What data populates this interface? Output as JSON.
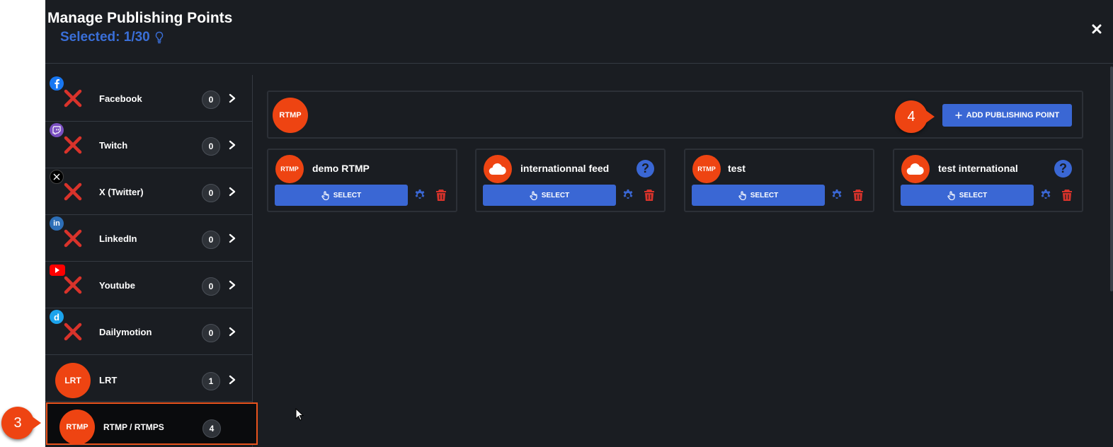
{
  "header": {
    "title": "Manage Publishing Points",
    "selected_label": "Selected: 1/30"
  },
  "colors": {
    "accent_blue": "#3a67d4",
    "accent_orange": "#ee4412",
    "danger_red": "#d9332b",
    "background": "#1a1d22"
  },
  "sidebar": {
    "items": [
      {
        "label": "Facebook",
        "count": "0",
        "icon": "facebook-icon"
      },
      {
        "label": "Twitch",
        "count": "0",
        "icon": "twitch-icon"
      },
      {
        "label": "X (Twitter)",
        "count": "0",
        "icon": "x-twitter-icon"
      },
      {
        "label": "LinkedIn",
        "count": "0",
        "icon": "linkedin-icon"
      },
      {
        "label": "Youtube",
        "count": "0",
        "icon": "youtube-icon"
      },
      {
        "label": "Dailymotion",
        "count": "0",
        "icon": "dailymotion-icon"
      },
      {
        "label": "LRT",
        "count": "1",
        "logo_text": "LRT"
      },
      {
        "label": "RTMP / RTMPS",
        "count": "4",
        "logo_text": "RTMP"
      }
    ]
  },
  "main": {
    "panel_logo_text": "RTMP",
    "add_button_label": "ADD PUBLISHING POINT",
    "cards": [
      {
        "title": "demo RTMP",
        "logo": "RTMP",
        "select_label": "SELECT"
      },
      {
        "title": "internationnal feed",
        "logo": "cloud-icon",
        "select_label": "SELECT"
      },
      {
        "title": "test",
        "logo": "RTMP",
        "select_label": "SELECT"
      },
      {
        "title": "test international",
        "logo": "cloud-icon",
        "select_label": "SELECT"
      }
    ]
  },
  "callouts": {
    "sidebar_step": "3",
    "add_step": "4"
  }
}
